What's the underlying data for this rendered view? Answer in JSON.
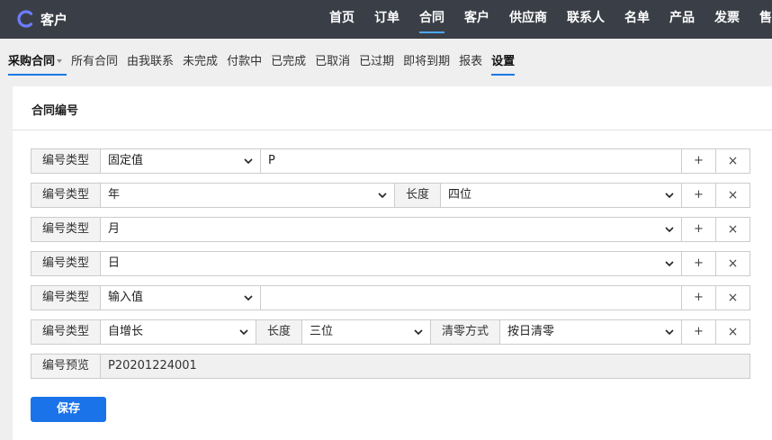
{
  "app": {
    "title": "客户",
    "logo_icon": "c-logo-icon",
    "accent": "#4aa8ff"
  },
  "mainnav": [
    {
      "label": "首页",
      "active": false
    },
    {
      "label": "订单",
      "active": false
    },
    {
      "label": "合同",
      "active": true
    },
    {
      "label": "客户",
      "active": false
    },
    {
      "label": "供应商",
      "active": false
    },
    {
      "label": "联系人",
      "active": false
    },
    {
      "label": "名单",
      "active": false
    },
    {
      "label": "产品",
      "active": false
    },
    {
      "label": "发票",
      "active": false
    },
    {
      "label": "售后",
      "active": false
    }
  ],
  "subnav": [
    {
      "label": "采购合同",
      "active": true,
      "dropdown": true
    },
    {
      "label": "所有合同"
    },
    {
      "label": "由我联系"
    },
    {
      "label": "未完成"
    },
    {
      "label": "付款中"
    },
    {
      "label": "已完成"
    },
    {
      "label": "已取消"
    },
    {
      "label": "已过期"
    },
    {
      "label": "即将到期"
    },
    {
      "label": "报表"
    },
    {
      "label": "设置",
      "active": true
    }
  ],
  "panel": {
    "title": "合同编号",
    "type_label": "编号类型",
    "length_label": "长度",
    "reset_label": "清零方式",
    "add_symbol": "+",
    "remove_symbol": "×",
    "rows": [
      {
        "type": "固定值",
        "value": "P"
      },
      {
        "type": "年",
        "length": "四位"
      },
      {
        "type": "月"
      },
      {
        "type": "日"
      },
      {
        "type": "输入值",
        "value": ""
      },
      {
        "type": "自增长",
        "length": "三位",
        "reset": "按日清零"
      }
    ],
    "preview_label": "编号预览",
    "preview_value": "P20201224001",
    "save_label": "保存",
    "save_color": "#1a73e8"
  }
}
